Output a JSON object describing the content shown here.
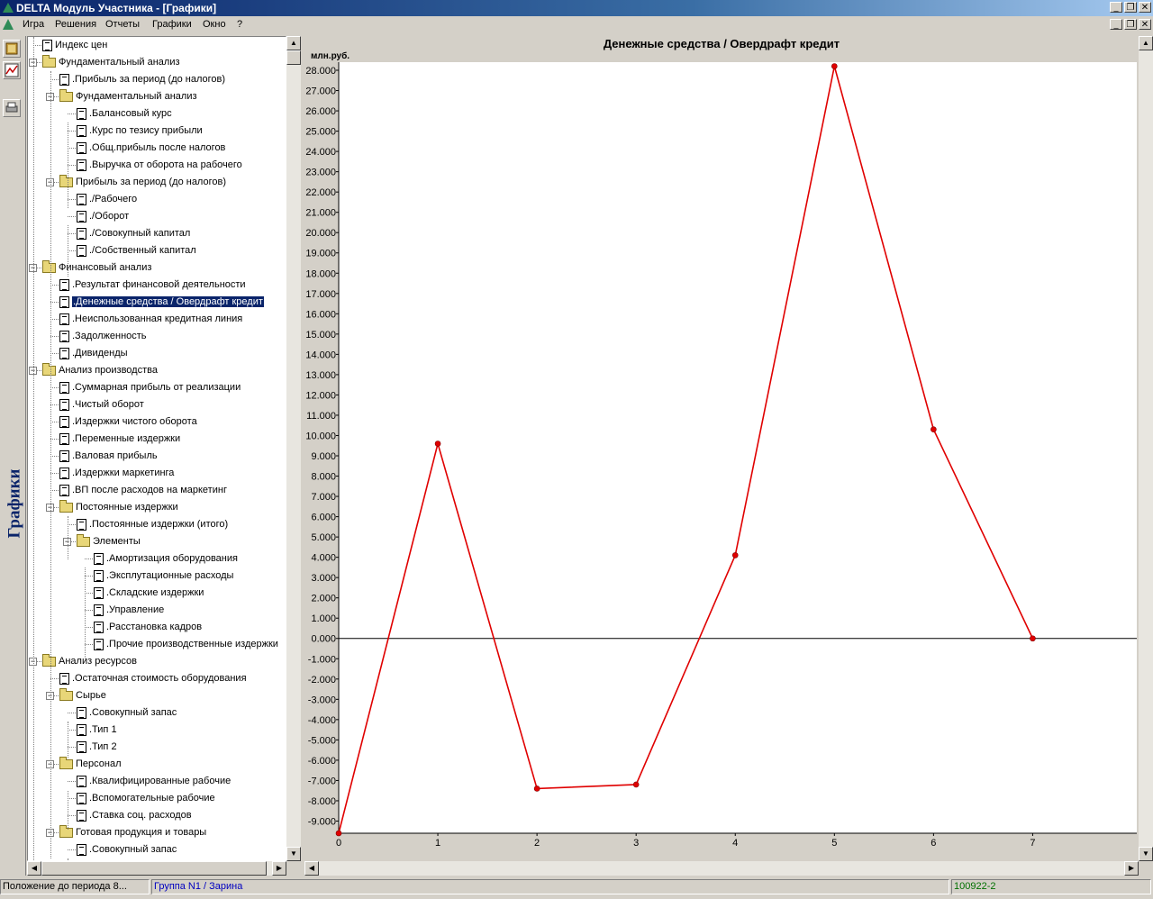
{
  "window": {
    "title": "DELTA Модуль Участника - [Графики]"
  },
  "menu": {
    "items": [
      "Игра",
      "Решения",
      "Отчеты",
      "Графики",
      "Окно",
      "?"
    ]
  },
  "sidebar": {
    "vertical_label": "Графики"
  },
  "tree": {
    "items": [
      {
        "label": "Индекс цен",
        "type": "doc",
        "level": 0
      },
      {
        "label": "Фундаментальный анализ",
        "type": "folder",
        "level": 0
      },
      {
        "label": ".Прибыль за период (до налогов)",
        "type": "doc",
        "level": 1
      },
      {
        "label": "Фундаментальный анализ",
        "type": "folder",
        "level": 1
      },
      {
        "label": ".Балансовый курс",
        "type": "doc",
        "level": 2
      },
      {
        "label": ".Курс по тезису прибыли",
        "type": "doc",
        "level": 2
      },
      {
        "label": ".Общ.прибыль после налогов",
        "type": "doc",
        "level": 2
      },
      {
        "label": ".Выручка от оборота на рабочего",
        "type": "doc",
        "level": 2
      },
      {
        "label": "Прибыль за период (до налогов)",
        "type": "folder",
        "level": 1
      },
      {
        "label": "./Рабочего",
        "type": "doc",
        "level": 2
      },
      {
        "label": "./Оборот",
        "type": "doc",
        "level": 2
      },
      {
        "label": "./Совокупный капитал",
        "type": "doc",
        "level": 2
      },
      {
        "label": "./Собственный капитал",
        "type": "doc",
        "level": 2
      },
      {
        "label": "Финансовый анализ",
        "type": "folder",
        "level": 0
      },
      {
        "label": ".Результат финансовой деятельности",
        "type": "doc",
        "level": 1
      },
      {
        "label": ".Денежные средства / Овердрафт кредит",
        "type": "doc",
        "level": 1,
        "selected": true
      },
      {
        "label": ".Неиспользованная кредитная линия",
        "type": "doc",
        "level": 1
      },
      {
        "label": ".Задолженность",
        "type": "doc",
        "level": 1
      },
      {
        "label": ".Дивиденды",
        "type": "doc",
        "level": 1
      },
      {
        "label": "Анализ производства",
        "type": "folder",
        "level": 0
      },
      {
        "label": ".Суммарная прибыль от реализации",
        "type": "doc",
        "level": 1
      },
      {
        "label": ".Чистый оборот",
        "type": "doc",
        "level": 1
      },
      {
        "label": ".Издержки чистого оборота",
        "type": "doc",
        "level": 1
      },
      {
        "label": ".Переменные издержки",
        "type": "doc",
        "level": 1
      },
      {
        "label": ".Валовая прибыль",
        "type": "doc",
        "level": 1
      },
      {
        "label": ".Издержки маркетинга",
        "type": "doc",
        "level": 1
      },
      {
        "label": ".ВП после расходов на маркетинг",
        "type": "doc",
        "level": 1
      },
      {
        "label": "Постоянные издержки",
        "type": "folder",
        "level": 1
      },
      {
        "label": ".Постоянные издержки (итого)",
        "type": "doc",
        "level": 2
      },
      {
        "label": "Элементы",
        "type": "folder",
        "level": 2
      },
      {
        "label": ".Амортизация оборудования",
        "type": "doc",
        "level": 3
      },
      {
        "label": ".Эксплутационные расходы",
        "type": "doc",
        "level": 3
      },
      {
        "label": ".Складские издержки",
        "type": "doc",
        "level": 3
      },
      {
        "label": ".Управление",
        "type": "doc",
        "level": 3
      },
      {
        "label": ".Расстановка кадров",
        "type": "doc",
        "level": 3
      },
      {
        "label": ".Прочие производственные издержки",
        "type": "doc",
        "level": 3
      },
      {
        "label": "Анализ ресурсов",
        "type": "folder",
        "level": 0
      },
      {
        "label": ".Остаточная стоимость оборудования",
        "type": "doc",
        "level": 1
      },
      {
        "label": "Сырье",
        "type": "folder",
        "level": 1
      },
      {
        "label": ".Совокупный запас",
        "type": "doc",
        "level": 2
      },
      {
        "label": ".Тип 1",
        "type": "doc",
        "level": 2
      },
      {
        "label": ".Тип 2",
        "type": "doc",
        "level": 2
      },
      {
        "label": "Персонал",
        "type": "folder",
        "level": 1
      },
      {
        "label": ".Квалифицированные рабочие",
        "type": "doc",
        "level": 2
      },
      {
        "label": ".Вспомогательные рабочие",
        "type": "doc",
        "level": 2
      },
      {
        "label": ".Ставка соц. расходов",
        "type": "doc",
        "level": 2
      },
      {
        "label": "Готовая продукция и товары",
        "type": "folder",
        "level": 1
      },
      {
        "label": ".Совокупный запас",
        "type": "doc",
        "level": 2
      }
    ]
  },
  "chart_data": {
    "type": "line",
    "title": "Денежные средства / Овердрафт кредит",
    "ylabel": "млн.руб.",
    "xlabel": "",
    "x": [
      0,
      1,
      2,
      3,
      4,
      5,
      6,
      7
    ],
    "values": [
      -9600,
      9600,
      -7400,
      -7200,
      4100,
      28200,
      10300,
      0
    ],
    "ylim": [
      -9600,
      28400
    ],
    "yticks": [
      28000,
      27000,
      26000,
      25000,
      24000,
      23000,
      22000,
      21000,
      20000,
      19000,
      18000,
      17000,
      16000,
      15000,
      14000,
      13000,
      12000,
      11000,
      10000,
      9000,
      8000,
      7000,
      6000,
      5000,
      4000,
      3000,
      2000,
      1000,
      0,
      -1000,
      -2000,
      -3000,
      -4000,
      -5000,
      -6000,
      -7000,
      -8000,
      -9000
    ],
    "ytick_labels": [
      "28.000",
      "27.000",
      "26.000",
      "25.000",
      "24.000",
      "23.000",
      "22.000",
      "21.000",
      "20.000",
      "19.000",
      "18.000",
      "17.000",
      "16.000",
      "15.000",
      "14.000",
      "13.000",
      "12.000",
      "11.000",
      "10.000",
      "9.000",
      "8.000",
      "7.000",
      "6.000",
      "5.000",
      "4.000",
      "3.000",
      "2.000",
      "1.000",
      "0.000",
      "-1.000",
      "-2.000",
      "-3.000",
      "-4.000",
      "-5.000",
      "-6.000",
      "-7.000",
      "-8.000",
      "-9.000"
    ],
    "xtick_labels": [
      "0",
      "1",
      "2",
      "3",
      "4",
      "5",
      "6",
      "7"
    ],
    "xlim": [
      0,
      8.05
    ],
    "line_color": "#e00000",
    "grid": false
  },
  "status": {
    "left": "Положение до периода 8...",
    "middle": "Группа N1 / Зарина",
    "right": "100922-2",
    "middle_color": "#0000c0",
    "right_color": "#007000"
  }
}
